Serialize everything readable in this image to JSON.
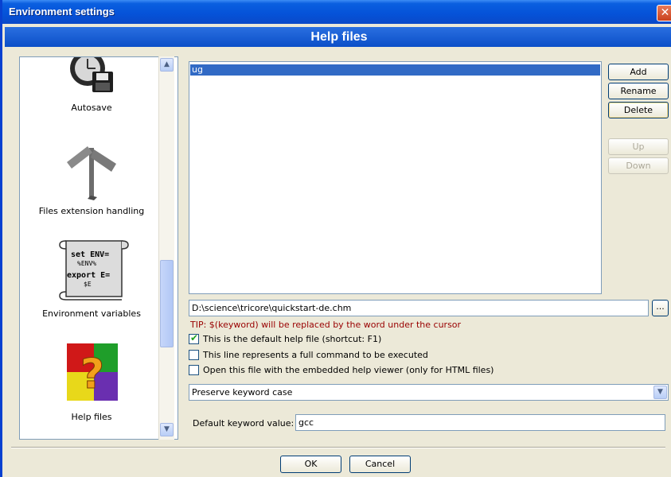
{
  "window": {
    "title": "Environment settings",
    "close_glyph": "✕"
  },
  "header": {
    "title": "Help files"
  },
  "sidebar": {
    "items": [
      {
        "label": "Autosave",
        "icon": "autosave-icon"
      },
      {
        "label": "Files extension handling",
        "icon": "signpost-icon"
      },
      {
        "label": "Environment variables",
        "icon": "scroll-icon",
        "icon_text": [
          "set ENV=",
          "%ENV%",
          "export E=",
          "$E"
        ]
      },
      {
        "label": "Help files",
        "icon": "help-box-icon",
        "icon_glyph": "?"
      }
    ],
    "scroll_up_glyph": "▲",
    "scroll_down_glyph": "▼"
  },
  "help_list": {
    "items": [
      {
        "label": "ug",
        "selected": true
      }
    ]
  },
  "buttons": {
    "add": "Add",
    "rename": "Rename",
    "delete": "Delete",
    "up": "Up",
    "down": "Down"
  },
  "path": {
    "value": "D:\\science\\tricore\\quickstart-de.chm",
    "browse_label": "..."
  },
  "tip": "TIP: $(keyword) will be replaced by the word under the cursor",
  "checkboxes": [
    {
      "label": "This is the default help file (shortcut: F1)",
      "checked": true,
      "mark": "✔"
    },
    {
      "label": "This line represents a full command to be executed",
      "checked": false,
      "mark": ""
    },
    {
      "label": "Open this file with the embedded help viewer (only for HTML files)",
      "checked": false,
      "mark": ""
    }
  ],
  "case_select": {
    "value": "Preserve keyword case",
    "arrow": "▼"
  },
  "default_keyword": {
    "label": "Default keyword value:",
    "value": "gcc"
  },
  "dialog": {
    "ok": "OK",
    "cancel": "Cancel"
  },
  "colors": {
    "selection": "#316ac5",
    "tip": "#990000",
    "titlebar": "#0552d8"
  }
}
